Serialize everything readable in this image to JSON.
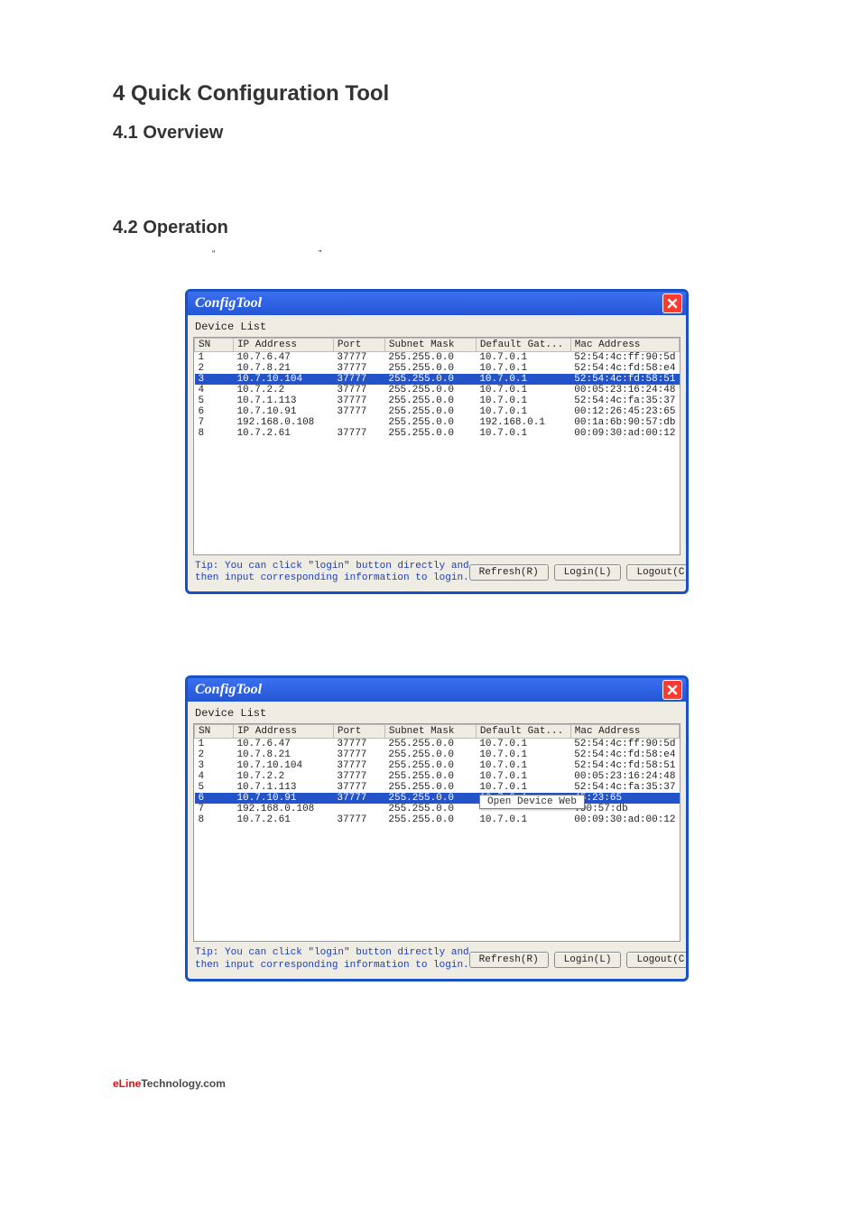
{
  "headings": {
    "h1": "4 Quick Configuration Tool",
    "h2a": "4.1 Overview",
    "h2b": "4.2 Operation"
  },
  "quotes": {
    "open": "“",
    "close": "”"
  },
  "window": {
    "title": "ConfigTool",
    "subheader": "Device List",
    "columns": {
      "sn": "SN",
      "ip": "IP Address",
      "port": "Port",
      "mask": "Subnet Mask",
      "gw": "Default Gat...",
      "mac": "Mac Address"
    },
    "tip": "Tip: You can click \"login\" button directly and\nthen input corresponding information to login.",
    "buttons": {
      "refresh": "Refresh(R)",
      "login": "Login(L)",
      "logout": "Logout(C)"
    },
    "context_menu": "Open Device Web"
  },
  "table1": {
    "selected_row": 2,
    "rows": [
      {
        "sn": "1",
        "ip": "10.7.6.47",
        "port": "37777",
        "mask": "255.255.0.0",
        "gw": "10.7.0.1",
        "mac": "52:54:4c:ff:90:5d"
      },
      {
        "sn": "2",
        "ip": "10.7.8.21",
        "port": "37777",
        "mask": "255.255.0.0",
        "gw": "10.7.0.1",
        "mac": "52:54:4c:fd:58:e4"
      },
      {
        "sn": "3",
        "ip": "10.7.10.104",
        "port": "37777",
        "mask": "255.255.0.0",
        "gw": "10.7.0.1",
        "mac": "52:54:4c:fd:58:51"
      },
      {
        "sn": "4",
        "ip": "10.7.2.2",
        "port": "37777",
        "mask": "255.255.0.0",
        "gw": "10.7.0.1",
        "mac": "00:05:23:16:24:48"
      },
      {
        "sn": "5",
        "ip": "10.7.1.113",
        "port": "37777",
        "mask": "255.255.0.0",
        "gw": "10.7.0.1",
        "mac": "52:54:4c:fa:35:37"
      },
      {
        "sn": "6",
        "ip": "10.7.10.91",
        "port": "37777",
        "mask": "255.255.0.0",
        "gw": "10.7.0.1",
        "mac": "00:12:26:45:23:65"
      },
      {
        "sn": "7",
        "ip": "192.168.0.108",
        "port": "",
        "mask": "255.255.0.0",
        "gw": "192.168.0.1",
        "mac": "00:1a:6b:90:57:db"
      },
      {
        "sn": "8",
        "ip": "10.7.2.61",
        "port": "37777",
        "mask": "255.255.0.0",
        "gw": "10.7.0.1",
        "mac": "00:09:30:ad:00:12"
      }
    ]
  },
  "table2": {
    "selected_row": 5,
    "rows": [
      {
        "sn": "1",
        "ip": "10.7.6.47",
        "port": "37777",
        "mask": "255.255.0.0",
        "gw": "10.7.0.1",
        "mac": "52:54:4c:ff:90:5d"
      },
      {
        "sn": "2",
        "ip": "10.7.8.21",
        "port": "37777",
        "mask": "255.255.0.0",
        "gw": "10.7.0.1",
        "mac": "52:54:4c:fd:58:e4"
      },
      {
        "sn": "3",
        "ip": "10.7.10.104",
        "port": "37777",
        "mask": "255.255.0.0",
        "gw": "10.7.0.1",
        "mac": "52:54:4c:fd:58:51"
      },
      {
        "sn": "4",
        "ip": "10.7.2.2",
        "port": "37777",
        "mask": "255.255.0.0",
        "gw": "10.7.0.1",
        "mac": "00:05:23:16:24:48"
      },
      {
        "sn": "5",
        "ip": "10.7.1.113",
        "port": "37777",
        "mask": "255.255.0.0",
        "gw": "10.7.0.1",
        "mac": "52:54:4c:fa:35:37"
      },
      {
        "sn": "6",
        "ip": "10.7.10.91",
        "port": "37777",
        "mask": "255.255.0.0",
        "gw": "10.7.0.1",
        "mac": "45:23:65"
      },
      {
        "sn": "7",
        "ip": "192.168.0.108",
        "port": "",
        "mask": "255.255.0.0",
        "gw": "",
        "mac": ":90:57:db"
      },
      {
        "sn": "8",
        "ip": "10.7.2.61",
        "port": "37777",
        "mask": "255.255.0.0",
        "gw": "10.7.0.1",
        "mac": "00:09:30:ad:00:12"
      }
    ]
  },
  "footer_brand": {
    "part1": "eLine",
    "part2": "Technology.com"
  }
}
